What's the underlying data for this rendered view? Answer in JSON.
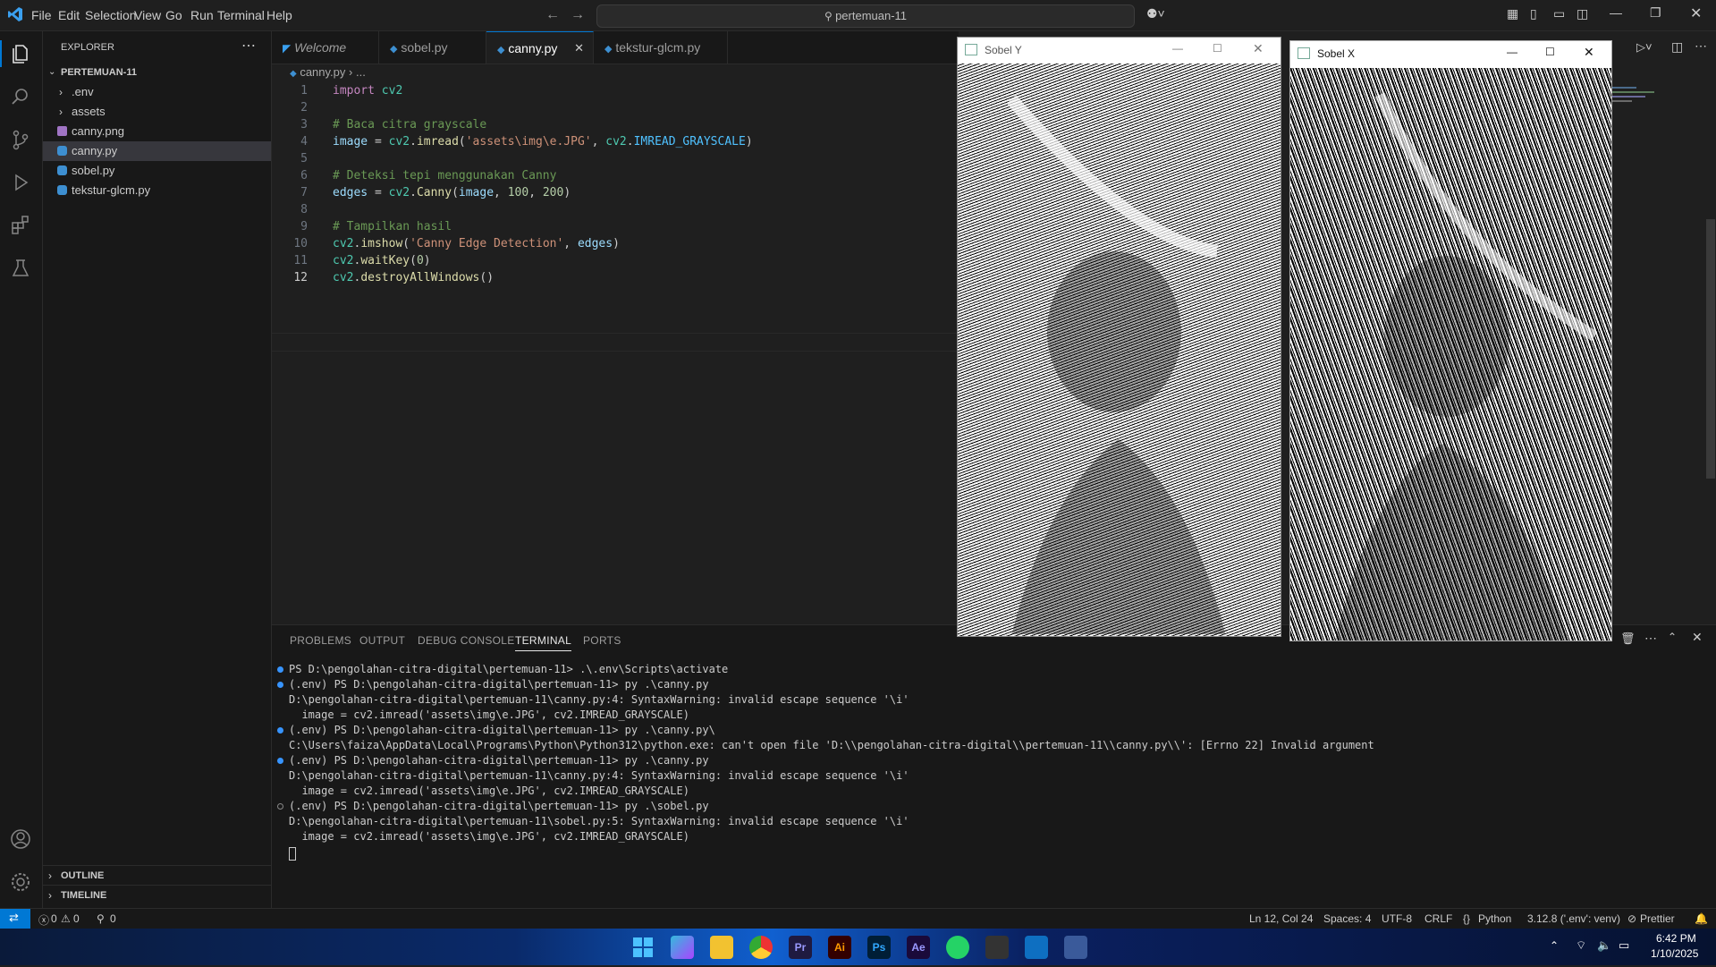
{
  "titlebar": {
    "menus": [
      "File",
      "Edit",
      "Selection",
      "View",
      "Go",
      "Run",
      "Terminal",
      "Help"
    ],
    "search_text": "pertemuan-11"
  },
  "sidebar": {
    "header": "EXPLORER",
    "folder": "PERTEMUAN-11",
    "items": [
      ".env",
      "assets",
      "canny.png",
      "canny.py",
      "sobel.py",
      "tekstur-glcm.py"
    ],
    "outline": "OUTLINE",
    "timeline": "TIMELINE"
  },
  "tabs": [
    "Welcome",
    "sobel.py",
    "canny.py",
    "tekstur-glcm.py"
  ],
  "breadcrumb": {
    "file": "canny.py",
    "rest": "..."
  },
  "editor": {
    "line_numbers": [
      "1",
      "2",
      "3",
      "4",
      "5",
      "6",
      "7",
      "8",
      "9",
      "10",
      "11",
      "12"
    ]
  },
  "panel": {
    "tabs": [
      "PROBLEMS",
      "OUTPUT",
      "DEBUG CONSOLE",
      "TERMINAL",
      "PORTS"
    ],
    "terminal_lines": [
      "PS D:\\pengolahan-citra-digital\\pertemuan-11> .\\.env\\Scripts\\activate",
      "(.env) PS D:\\pengolahan-citra-digital\\pertemuan-11> py .\\canny.py",
      "D:\\pengolahan-citra-digital\\pertemuan-11\\canny.py:4: SyntaxWarning: invalid escape sequence '\\i'",
      "  image = cv2.imread('assets\\img\\e.JPG', cv2.IMREAD_GRAYSCALE)",
      "(.env) PS D:\\pengolahan-citra-digital\\pertemuan-11> py .\\canny.py\\",
      "C:\\Users\\faiza\\AppData\\Local\\Programs\\Python\\Python312\\python.exe: can't open file 'D:\\\\pengolahan-citra-digital\\\\pertemuan-11\\\\canny.py\\\\': [Errno 22] Invalid argument",
      "(.env) PS D:\\pengolahan-citra-digital\\pertemuan-11> py .\\canny.py",
      "D:\\pengolahan-citra-digital\\pertemuan-11\\canny.py:4: SyntaxWarning: invalid escape sequence '\\i'",
      "  image = cv2.imread('assets\\img\\e.JPG', cv2.IMREAD_GRAYSCALE)",
      "(.env) PS D:\\pengolahan-citra-digital\\pertemuan-11> py .\\sobel.py",
      "D:\\pengolahan-citra-digital\\pertemuan-11\\sobel.py:5: SyntaxWarning: invalid escape sequence '\\i'",
      "  image = cv2.imread('assets\\img\\e.JPG', cv2.IMREAD_GRAYSCALE)"
    ]
  },
  "windows": {
    "sobel_y": "Sobel Y",
    "sobel_x": "Sobel X"
  },
  "status": {
    "errors": "0",
    "warnings": "0",
    "ports": "0",
    "position": "Ln 12, Col 24",
    "spaces": "Spaces: 4",
    "encoding": "UTF-8",
    "eol": "CRLF",
    "language": "Python",
    "interpreter": "3.12.8 ('.env': venv)",
    "prettier": "Prettier"
  },
  "taskbar": {
    "apps": [
      "Pr",
      "Ai",
      "Ps",
      "Ae"
    ],
    "time": "6:42 PM",
    "date": "1/10/2025"
  },
  "colors": {
    "accent": "#0078d4",
    "background": "#1f1f1f",
    "sidebar": "#181818"
  }
}
